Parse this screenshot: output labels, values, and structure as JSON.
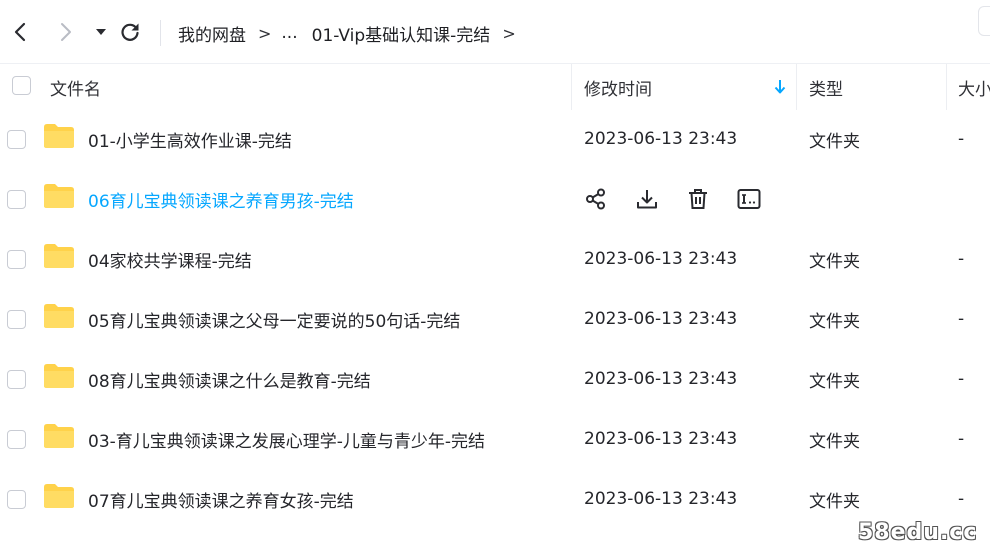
{
  "toolbar": {
    "back_icon": "chevron-left-icon",
    "forward_icon": "chevron-right-icon",
    "history_icon": "caret-down-icon",
    "refresh_icon": "refresh-icon",
    "breadcrumb": [
      "我的网盘",
      "...",
      "01-Vip基础认知课-完结"
    ],
    "separator": ">"
  },
  "header": {
    "name": "文件名",
    "modified": "修改时间",
    "type": "类型",
    "size": "大小"
  },
  "rows": [
    {
      "name": "01-小学生高效作业课-完结",
      "time": "2023-06-13 23:43",
      "type": "文件夹",
      "size": "-"
    },
    {
      "name": "06育儿宝典领读课之养育男孩-完结",
      "hovered": true,
      "actions": [
        "share-icon",
        "download-icon",
        "delete-icon",
        "rename-icon"
      ]
    },
    {
      "name": "04家校共学课程-完结",
      "time": "2023-06-13 23:43",
      "type": "文件夹",
      "size": "-"
    },
    {
      "name": "05育儿宝典领读课之父母一定要说的50句话-完结",
      "time": "2023-06-13 23:43",
      "type": "文件夹",
      "size": "-"
    },
    {
      "name": "08育儿宝典领读课之什么是教育-完结",
      "time": "2023-06-13 23:43",
      "type": "文件夹",
      "size": "-"
    },
    {
      "name": "03-育儿宝典领读课之发展心理学-儿童与青少年-完结",
      "time": "2023-06-13 23:43",
      "type": "文件夹",
      "size": "-"
    },
    {
      "name": "07育儿宝典领读课之养育女孩-完结",
      "time": "2023-06-13 23:43",
      "type": "文件夹",
      "size": "-"
    }
  ],
  "colors": {
    "accent": "#06a7ff",
    "folder": "#ffd24a"
  },
  "watermark": "58edu.cc"
}
